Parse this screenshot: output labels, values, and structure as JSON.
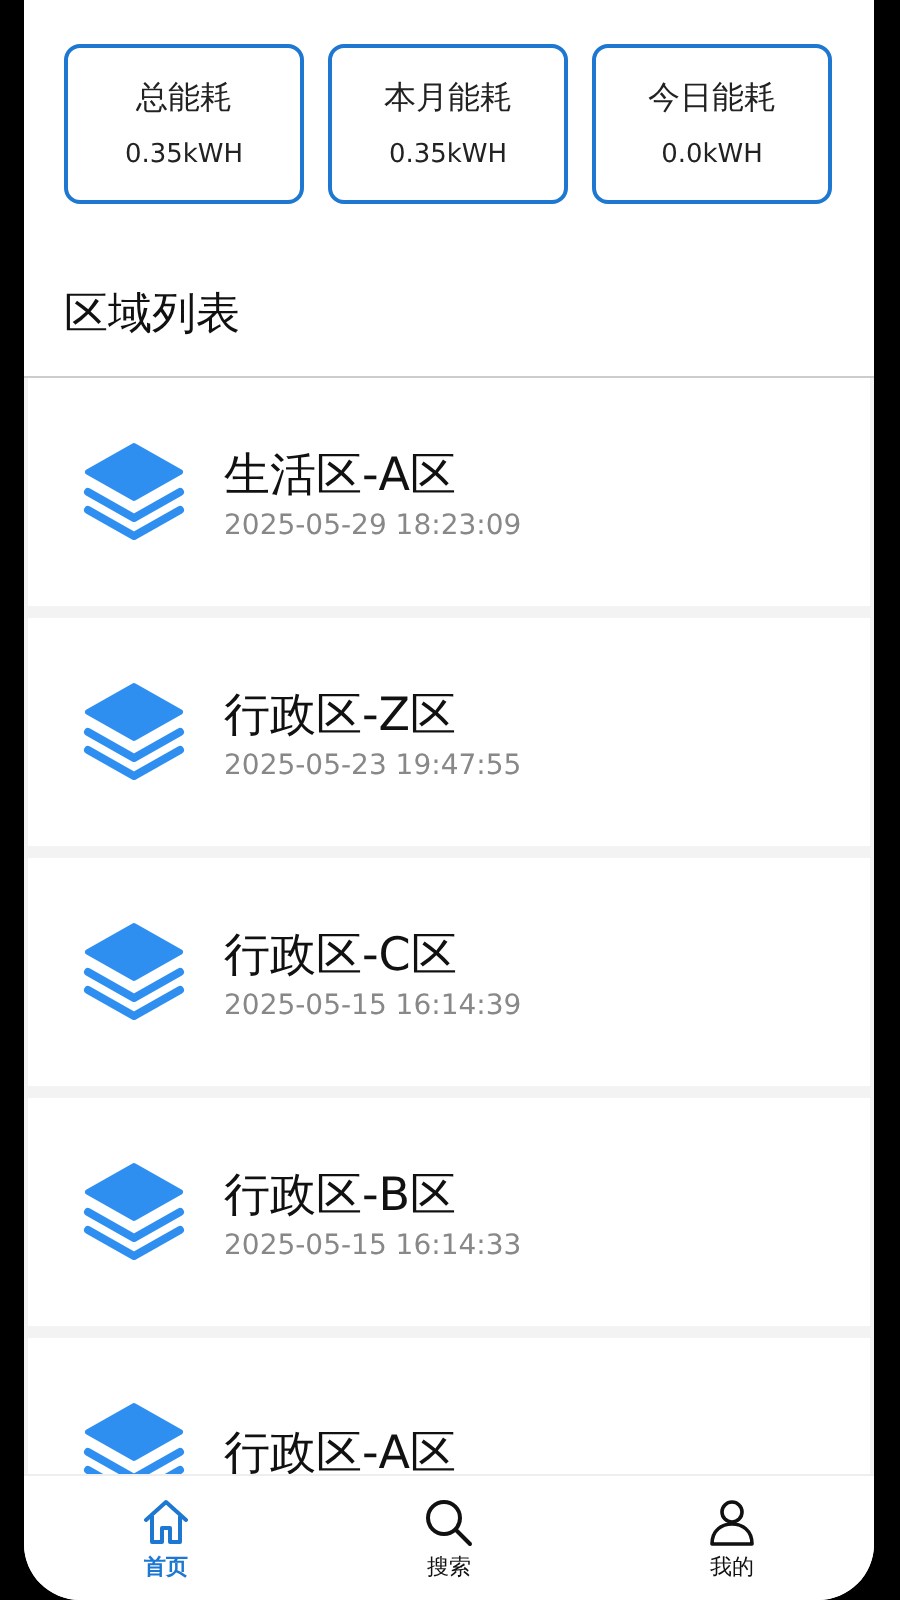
{
  "stats": [
    {
      "label": "总能耗",
      "value": "0.35kWH"
    },
    {
      "label": "本月能耗",
      "value": "0.35kWH"
    },
    {
      "label": "今日能耗",
      "value": "0.0kWH"
    }
  ],
  "section_title": "区域列表",
  "areas": [
    {
      "name": "生活区-A区",
      "time": "2025-05-29 18:23:09"
    },
    {
      "name": "行政区-Z区",
      "time": "2025-05-23 19:47:55"
    },
    {
      "name": "行政区-C区",
      "time": "2025-05-15 16:14:39"
    },
    {
      "name": "行政区-B区",
      "time": "2025-05-15 16:14:33"
    },
    {
      "name": "行政区-A区"
    }
  ],
  "tabs": [
    {
      "label": "首页",
      "kind": "home",
      "selected": true
    },
    {
      "label": "搜索",
      "kind": "search",
      "selected": false
    },
    {
      "label": "我的",
      "kind": "person",
      "selected": false
    }
  ]
}
